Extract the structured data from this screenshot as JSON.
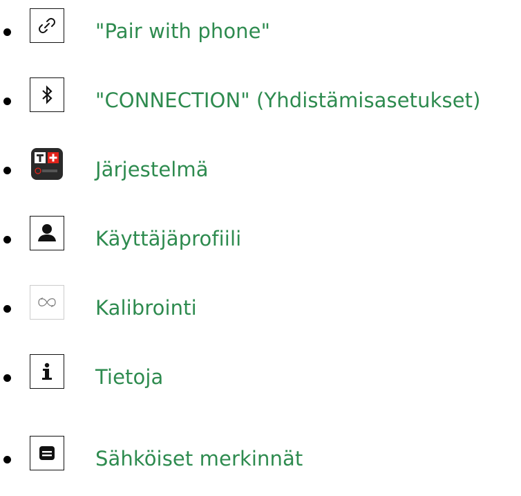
{
  "items": [
    {
      "icon": "link-icon",
      "label": "\"Pair with phone\""
    },
    {
      "icon": "bluetooth-icon",
      "label": "\"CONNECTION\" (Yhdistämisasetukset)"
    },
    {
      "icon": "t-touch-app-icon",
      "label": "Järjestelmä",
      "app_icon_text": "TOUCH"
    },
    {
      "icon": "user-profile-icon",
      "label": "Käyttäjäprofiili"
    },
    {
      "icon": "calibration-icon",
      "label": "Kalibrointi"
    },
    {
      "icon": "info-icon",
      "label": "Tietoja"
    },
    {
      "icon": "e-labels-icon",
      "label": "Sähköiset merkinnät"
    }
  ],
  "colors": {
    "label": "#2e8b4f",
    "bullet": "#000000",
    "icon_border": "#111111",
    "app_icon_bg": "#2a2a2a",
    "app_icon_red": "#e2231a"
  }
}
